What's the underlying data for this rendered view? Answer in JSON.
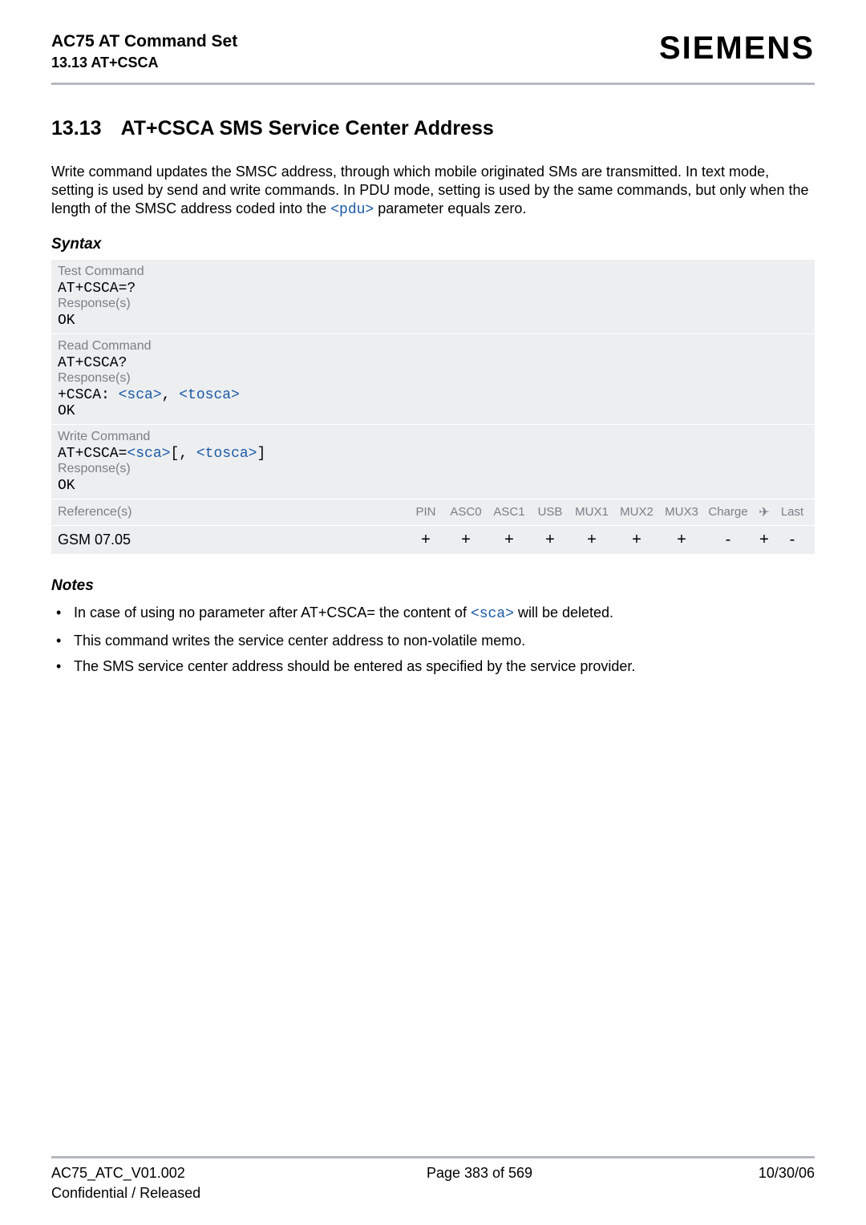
{
  "header": {
    "title": "AC75 AT Command Set",
    "subtitle": "13.13 AT+CSCA",
    "logo": "SIEMENS"
  },
  "section": {
    "number": "13.13",
    "title": "AT+CSCA   SMS Service Center Address"
  },
  "intro": {
    "l1_pre": "Write command updates the SMSC address, through which mobile originated SMs are transmitted. In text mode, setting is used by send and write commands. In PDU mode, setting is used by the same commands, but only when the length of the SMSC address coded into the ",
    "l1_param": "<pdu>",
    "l1_post": " parameter equals zero."
  },
  "syntax": {
    "heading": "Syntax",
    "test_label": "Test Command",
    "test_cmd": "AT+CSCA=?",
    "resp_label": "Response(s)",
    "ok": "OK",
    "read_label": "Read Command",
    "read_cmd": "AT+CSCA?",
    "read_resp_pre": "+CSCA: ",
    "sca": "<sca>",
    "comma": ", ",
    "tosca": "<tosca>",
    "write_label": "Write Command",
    "write_pre": "AT+CSCA=",
    "write_br_open": "[",
    "write_comma": ", ",
    "write_br_close": "]",
    "ref_label": "Reference(s)",
    "ref_value": "GSM 07.05",
    "cols": {
      "c0": "PIN",
      "c1": "ASC0",
      "c2": "ASC1",
      "c3": "USB",
      "c4": "MUX1",
      "c5": "MUX2",
      "c6": "MUX3",
      "c7": "Charge",
      "c8": "✈",
      "c9": "Last"
    },
    "vals": {
      "c0": "+",
      "c1": "+",
      "c2": "+",
      "c3": "+",
      "c4": "+",
      "c5": "+",
      "c6": "+",
      "c7": "-",
      "c8": "+",
      "c9": "-"
    }
  },
  "notes": {
    "heading": "Notes",
    "n1_pre": "In case of using no parameter after AT+CSCA= the content of ",
    "n1_param": "<sca>",
    "n1_post": " will be deleted.",
    "n2": "This command writes the service center address to non-volatile memo.",
    "n3": "The SMS service center address should be entered as specified by the service provider."
  },
  "footer": {
    "left_l1": "AC75_ATC_V01.002",
    "left_l2": "Confidential / Released",
    "center": "Page 383 of 569",
    "right": "10/30/06"
  }
}
